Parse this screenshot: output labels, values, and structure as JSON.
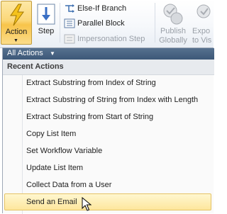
{
  "ribbon": {
    "action_label": "Action",
    "step_label": "Step",
    "else_if_label": "Else-If Branch",
    "parallel_label": "Parallel Block",
    "impersonation_label": "Impersonation Step",
    "publish_line1": "Publish",
    "publish_line2": "Globally",
    "export_line1": "Expo",
    "export_line2": "to Vis"
  },
  "menu": {
    "filter_label": "All Actions",
    "section_header": "Recent Actions",
    "items": [
      {
        "label": "Extract Substring from Index of String"
      },
      {
        "label": "Extract Substring of String from Index with Length"
      },
      {
        "label": "Extract Substring from Start of String"
      },
      {
        "label": "Copy List Item"
      },
      {
        "label": "Set Workflow Variable"
      },
      {
        "label": "Update List Item"
      },
      {
        "label": "Collect Data from a User"
      },
      {
        "label": "Send an Email",
        "hovered": true
      }
    ]
  },
  "colors": {
    "hover_fill": "#fde69c",
    "filter_bar": "#3d5878",
    "disabled_text": "#9aa0a8"
  }
}
